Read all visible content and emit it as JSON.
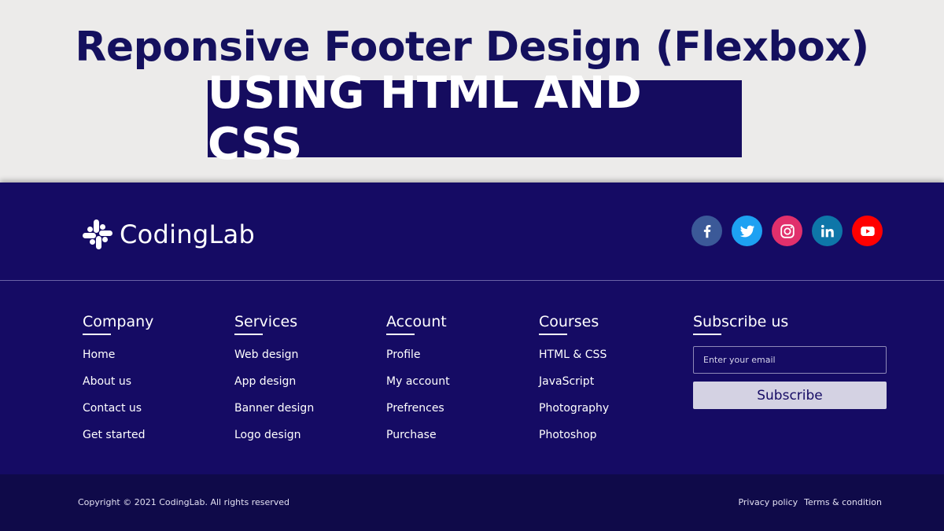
{
  "banner": {
    "headline": "Reponsive Footer Design (Flexbox)",
    "subline": "USING HTML AND CSS"
  },
  "footer": {
    "logo_text": "CodingLab",
    "social_icons": [
      "facebook-icon",
      "twitter-icon",
      "instagram-icon",
      "linkedin-icon",
      "youtube-icon"
    ],
    "columns": [
      {
        "title": "Company",
        "links": [
          "Home",
          "About us",
          "Contact us",
          "Get started"
        ]
      },
      {
        "title": "Services",
        "links": [
          "Web design",
          "App design",
          "Banner design",
          "Logo design"
        ]
      },
      {
        "title": "Account",
        "links": [
          "Profile",
          "My account",
          "Prefrences",
          "Purchase"
        ]
      },
      {
        "title": "Courses",
        "links": [
          "HTML & CSS",
          "JavaScript",
          "Photography",
          "Photoshop"
        ]
      }
    ],
    "subscribe": {
      "title": "Subscribe us",
      "email_placeholder": "Enter your email",
      "button_label": "Subscribe"
    }
  },
  "bottom_bar": {
    "copyright": "Copyright © 2021 CodingLab. All rights reserved",
    "links": [
      "Privacy policy",
      "Terms & condition"
    ]
  },
  "colors": {
    "banner_text": "#14105e",
    "footer_bg": "#150b64",
    "bottom_bar_bg": "#0f0a49",
    "facebook": "#3b5998",
    "twitter": "#1da1f2",
    "instagram": "#e1306c",
    "linkedin": "#0e76a8",
    "youtube": "#ff0000"
  }
}
